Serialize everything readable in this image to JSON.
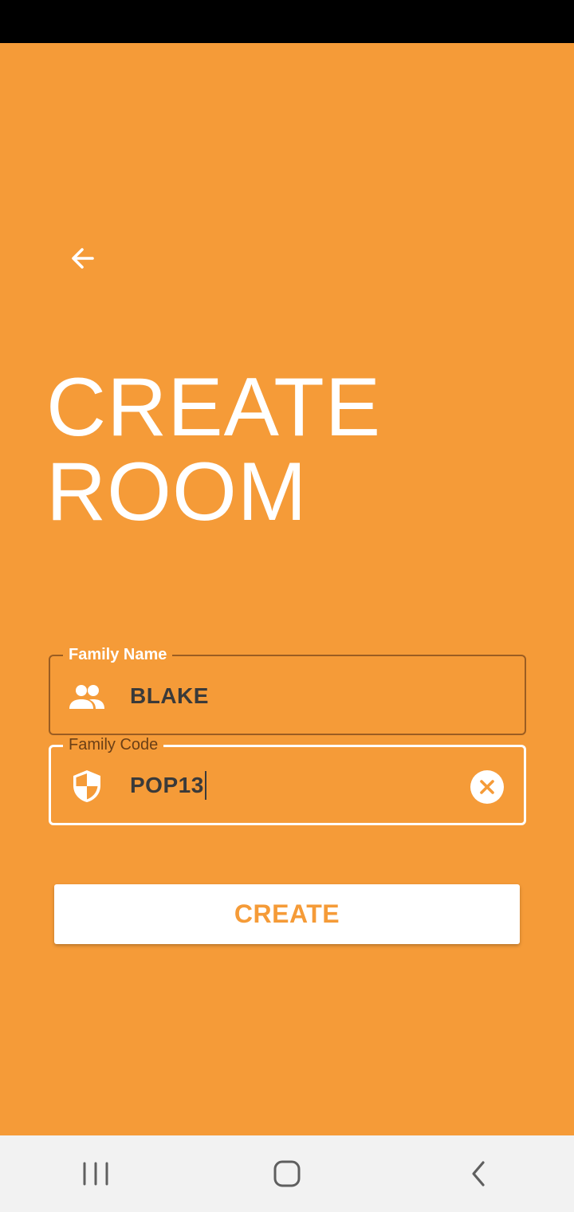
{
  "title": {
    "line1": "CREATE",
    "line2": "ROOM"
  },
  "form": {
    "family_name": {
      "label": "Family Name",
      "value": "BLAKE",
      "icon": "people-icon"
    },
    "family_code": {
      "label": "Family Code",
      "value": "POP13",
      "icon": "shield-icon"
    }
  },
  "create_label": "CREATE",
  "colors": {
    "background": "#F59B38",
    "text_dark": "#3a3a3a",
    "outline_unfocused": "#9B5D22",
    "outline_focused": "#FFFFFF"
  },
  "nav": {
    "recents_icon": "recents-icon",
    "home_icon": "home-icon",
    "back_icon": "back-chevron-icon"
  }
}
